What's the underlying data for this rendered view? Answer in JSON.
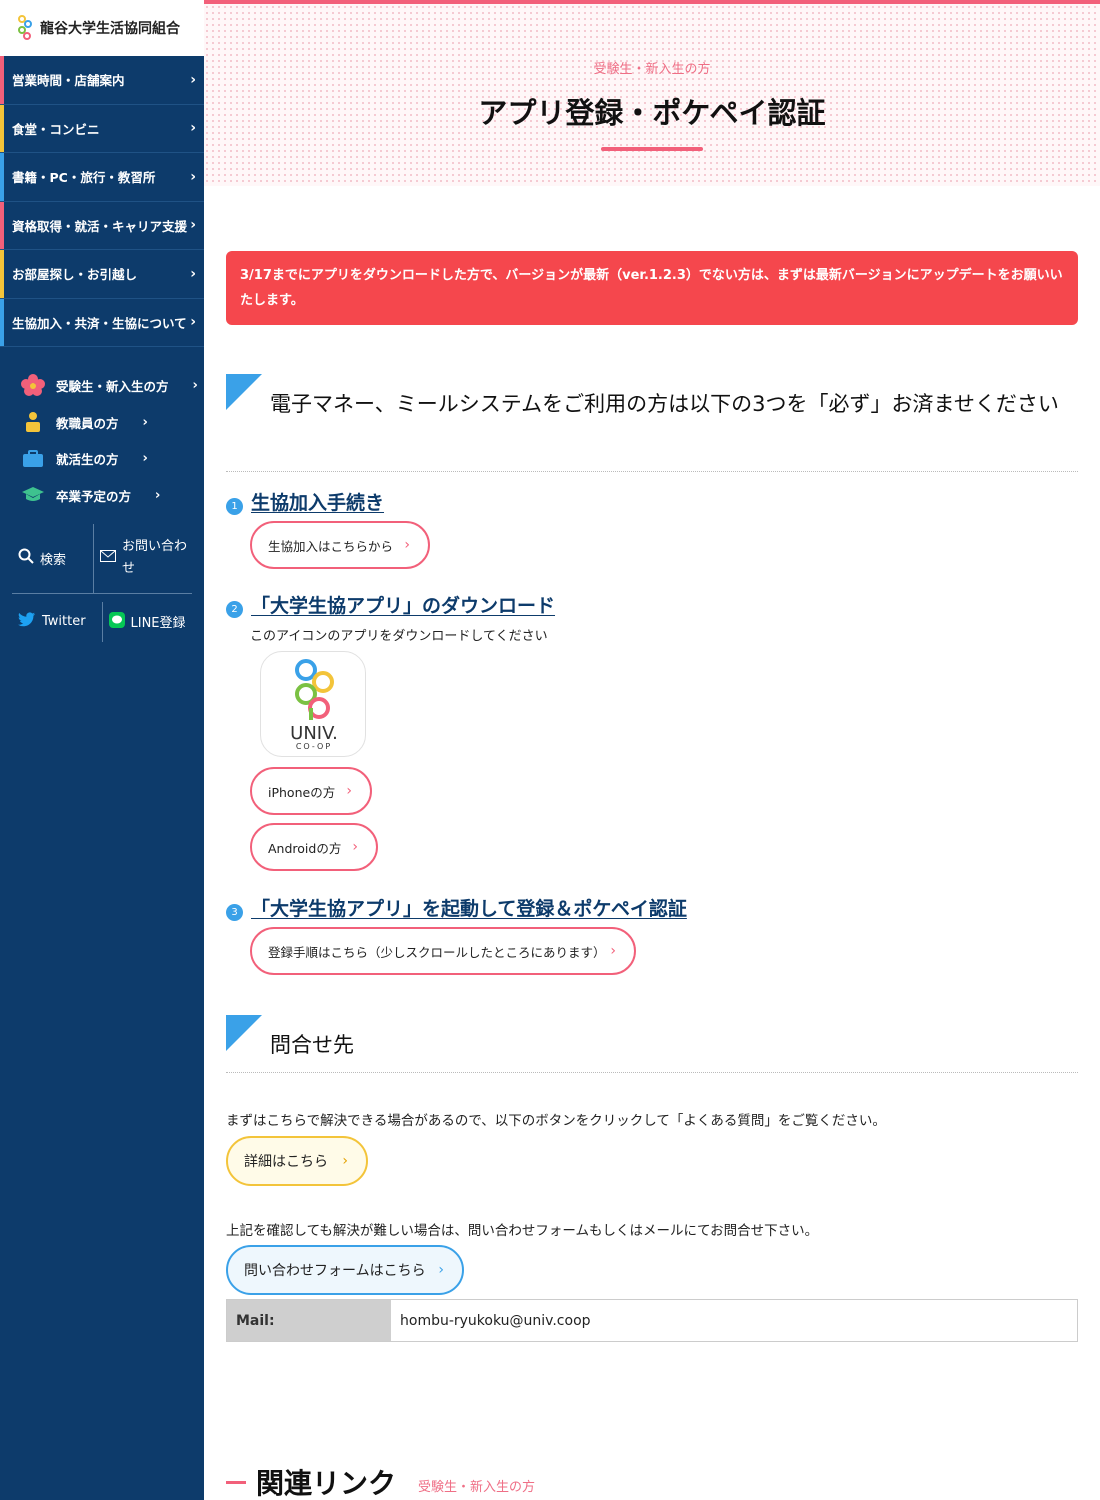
{
  "site": {
    "name": "龍谷大学生活協同組合"
  },
  "sidebar": {
    "nav": [
      {
        "label": "営業時間・店舗案内",
        "color": "#f2607a"
      },
      {
        "label": "食堂・コンビニ",
        "color": "#f3c43a"
      },
      {
        "label": "書籍・PC・旅行・教習所",
        "color": "#3aa1e8"
      },
      {
        "label": "資格取得・就活・キャリア支援",
        "color": "#f2607a"
      },
      {
        "label": "お部屋探し・お引越し",
        "color": "#f3c43a"
      },
      {
        "label": "生協加入・共済・生協について",
        "color": "#3aa1e8"
      }
    ],
    "personas": [
      {
        "label": "受験生・新入生の方",
        "icon": "flower-icon"
      },
      {
        "label": "教職員の方",
        "icon": "teacher-icon"
      },
      {
        "label": "就活生の方",
        "icon": "briefcase-icon"
      },
      {
        "label": "卒業予定の方",
        "icon": "graduation-cap-icon"
      }
    ],
    "search_label": "検索",
    "contact_label": "お問い合わせ",
    "twitter_label": "Twitter",
    "line_label": "LINE登録"
  },
  "hero": {
    "eyebrow": "受験生・新入生の方",
    "title": "アプリ登録・ポケペイ認証"
  },
  "alert": "3/17までにアプリをダウンロードした方で、バージョンが最新（ver.1.2.3）でない方は、まずは最新バージョンにアップデートをお願いいたします。",
  "section1": {
    "heading": "電子マネー、ミールシステムをご利用の方は以下の3つを「必ず」お済ませください",
    "steps": [
      {
        "num": "1",
        "title": "生協加入手続き"
      },
      {
        "num": "2",
        "title": "「大学生協アプリ」のダウンロード"
      },
      {
        "num": "3",
        "title": "「大学生協アプリ」を起動して登録＆ポケペイ認証"
      }
    ],
    "join_button": "生協加入はこちらから",
    "download_caption": "このアイコンのアプリをダウンロードしてください",
    "app_icon_text": "UNIV.",
    "app_icon_sub": "CO-OP",
    "iphone_button": "iPhoneの方",
    "android_button": "Androidの方",
    "register_button": "登録手順はこちら（少しスクロールしたところにあります）"
  },
  "section2": {
    "heading": "問合せ先",
    "para1": "まずはこちらで解決できる場合があるので、以下のボタンをクリックして「よくある質問」をご覧ください。",
    "faq_button": "詳細はこちら",
    "para2": "上記を確認しても解決が難しい場合は、問い合わせフォームもしくはメールにてお問合せ下さい。",
    "form_button": "問い合わせフォームはこちら",
    "mail_label": "Mail:",
    "mail_value": "hombu-ryukoku@univ.coop"
  },
  "related": {
    "title": "関連リンク",
    "sub": "受験生・新入生の方"
  }
}
